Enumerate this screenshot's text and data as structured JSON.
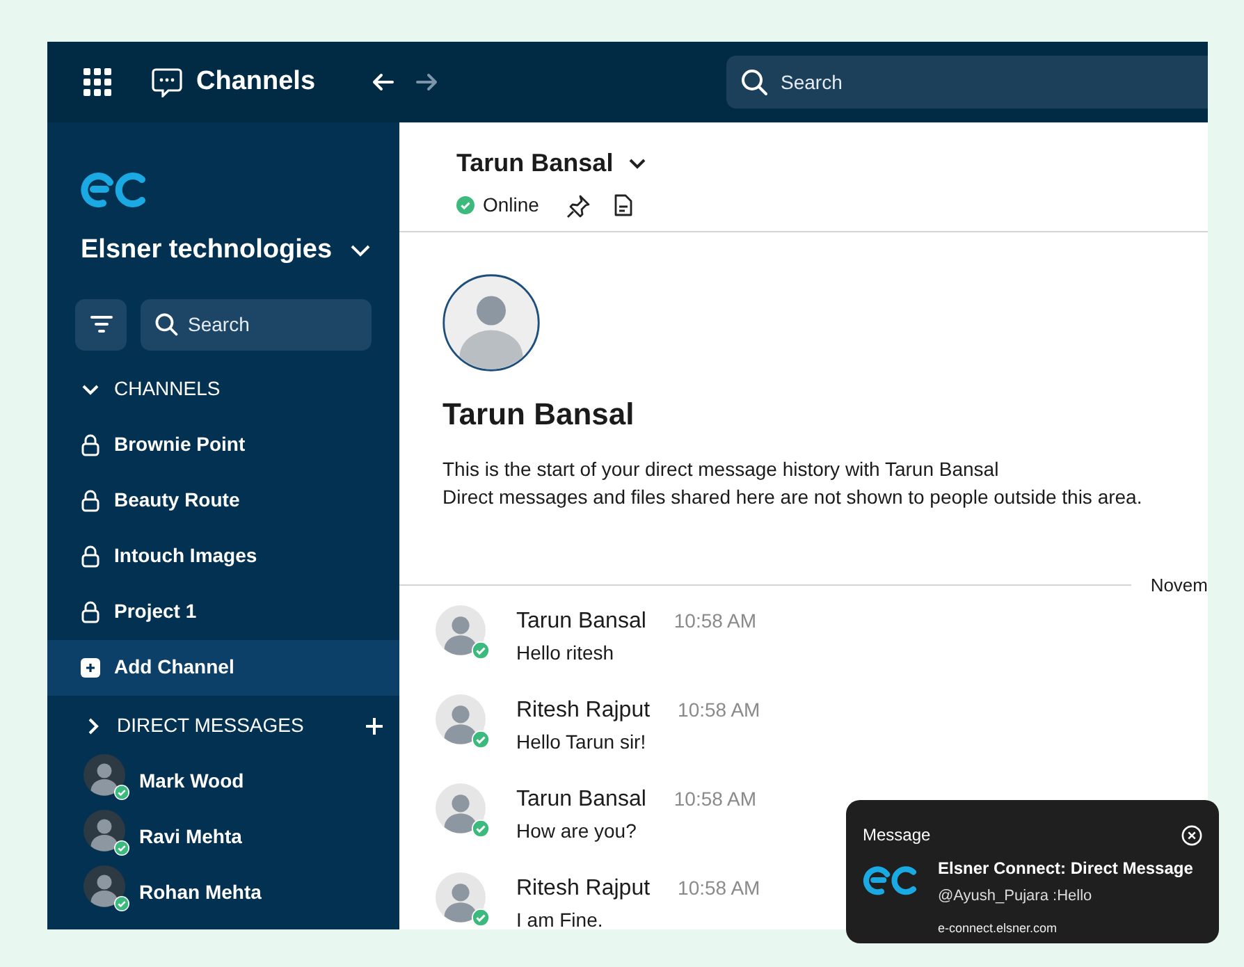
{
  "topbar": {
    "app_title": "Channels",
    "back": {
      "disabled": false
    },
    "forward": {
      "disabled": true
    },
    "search": {
      "placeholder": "Search"
    }
  },
  "sidebar": {
    "workspace": "Elsner technologies",
    "search": {
      "placeholder": "Search"
    },
    "channels_header": {
      "label": "CHANNELS",
      "expanded": true
    },
    "channels": [
      {
        "kind": "private",
        "label": "Brownie Point",
        "selected": false
      },
      {
        "kind": "private",
        "label": "Beauty Route",
        "selected": false
      },
      {
        "kind": "private",
        "label": "Intouch Images",
        "selected": false
      },
      {
        "kind": "private",
        "label": "Project 1",
        "selected": false
      },
      {
        "kind": "add",
        "label": "Add Channel",
        "selected": true
      }
    ],
    "dm_header": {
      "label": "DIRECT MESSAGES",
      "expanded": false
    },
    "direct_messages": [
      {
        "name": "Mark Wood",
        "online": true
      },
      {
        "name": "Ravi Mehta",
        "online": true
      },
      {
        "name": "Rohan Mehta",
        "online": true
      }
    ]
  },
  "conversation": {
    "name": "Tarun Bansal",
    "status": "Online",
    "intro": {
      "name": "Tarun Bansal",
      "lines": [
        "This is the start of your direct message history with Tarun Bansal",
        "Direct messages and files shared here are not shown to people outside this area."
      ]
    },
    "date_divider": "Novem",
    "messages": [
      {
        "author": "Tarun Bansal",
        "time": "10:58 AM",
        "text": "Hello ritesh",
        "online": true
      },
      {
        "author": "Ritesh Rajput",
        "time": "10:58 AM",
        "text": "Hello Tarun sir!",
        "online": true
      },
      {
        "author": "Tarun Bansal",
        "time": "10:58 AM",
        "text": "How are you?",
        "online": true
      },
      {
        "author": "Ritesh Rajput",
        "time": "10:58 AM",
        "text": "I am Fine.",
        "online": true
      }
    ]
  },
  "notification": {
    "heading": "Message",
    "title": "Elsner Connect: Direct Message",
    "body": "@Ayush_Pujara :Hello",
    "source": "e-connect.elsner.com"
  }
}
